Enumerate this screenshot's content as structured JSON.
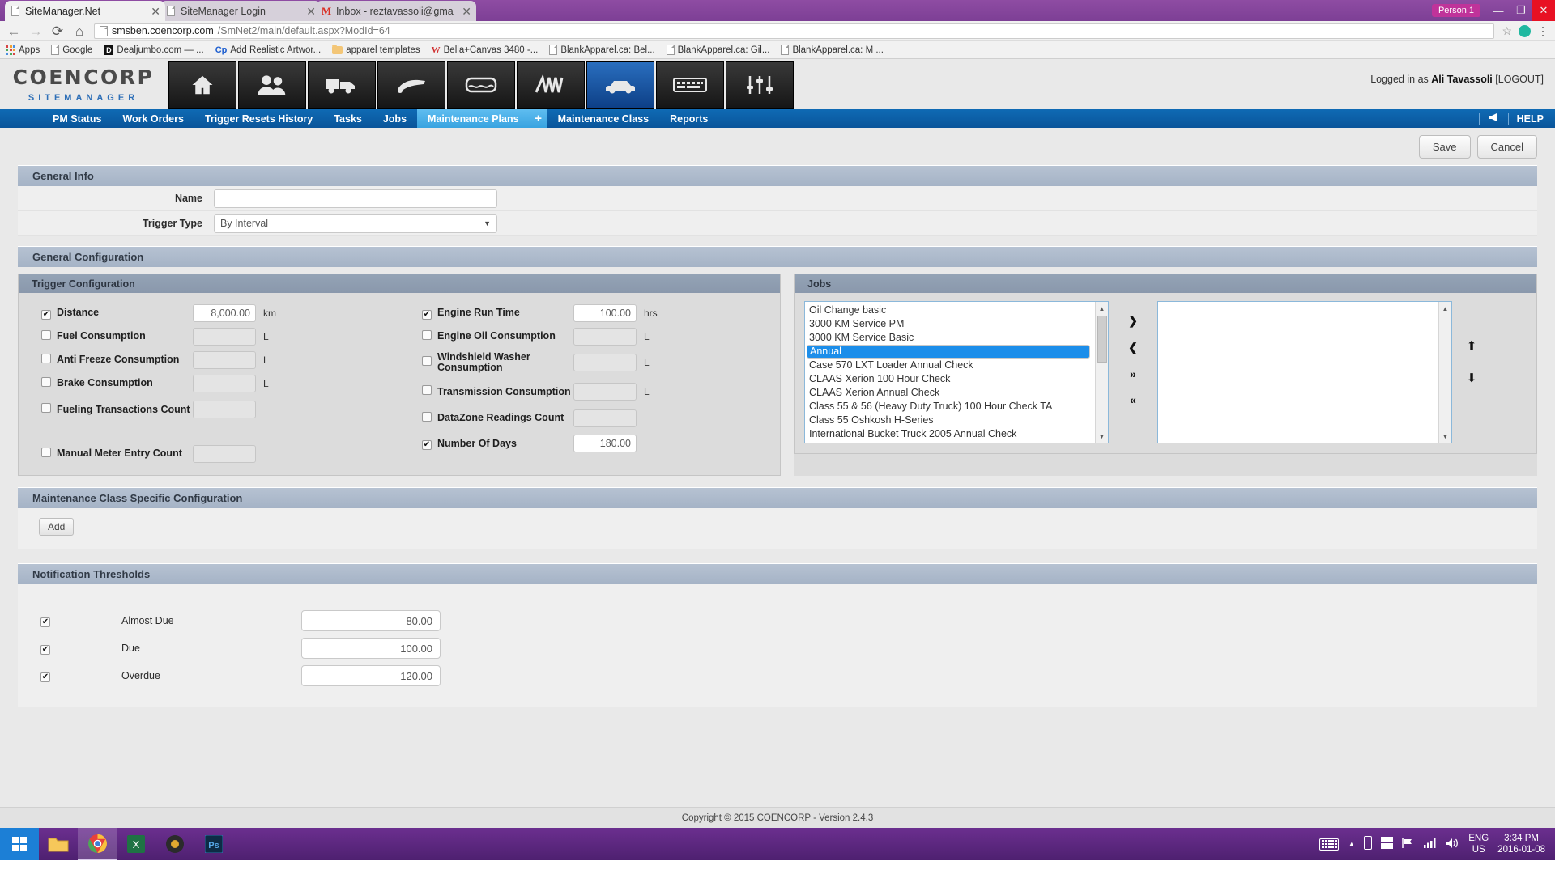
{
  "browser": {
    "tabs": [
      {
        "title": "SiteManager.Net",
        "icon": "document-icon",
        "active": true
      },
      {
        "title": "SiteManager Login",
        "icon": "document-icon",
        "active": false
      },
      {
        "title": "Inbox - reztavassoli@gma",
        "icon": "gmail-icon",
        "active": false
      }
    ],
    "window": {
      "person_label": "Person 1",
      "minimize": "—",
      "maximize": "❐",
      "close": "✕"
    },
    "toolbar": {
      "back": "←",
      "forward": "→",
      "reload": "⟳",
      "home": "⌂",
      "url_host": "smsben.coencorp.com",
      "url_path": "/SmNet2/main/default.aspx?ModId=64",
      "star": "☆",
      "menu": "⋮"
    },
    "bookmarks": [
      {
        "label": "Apps",
        "icon": "apps-grid-icon"
      },
      {
        "label": "Google",
        "icon": "document-icon"
      },
      {
        "label": "Dealjumbo.com — ...",
        "icon": "dealjumbo-icon"
      },
      {
        "label": "Add Realistic Artwor...",
        "icon": "cp-icon"
      },
      {
        "label": "apparel templates",
        "icon": "folder-icon"
      },
      {
        "label": "Bella+Canvas 3480 -...",
        "icon": "w-icon"
      },
      {
        "label": "BlankApparel.ca: Bel...",
        "icon": "document-icon"
      },
      {
        "label": "BlankApparel.ca: Gil...",
        "icon": "document-icon"
      },
      {
        "label": "BlankApparel.ca: M ...",
        "icon": "document-icon"
      }
    ]
  },
  "app": {
    "logo_main": "COENCORP",
    "logo_sub": "SITEMANAGER",
    "nav_icons": [
      {
        "name": "home-icon",
        "active": false
      },
      {
        "name": "people-icon",
        "active": false
      },
      {
        "name": "truck-icon",
        "active": false
      },
      {
        "name": "fuel-nozzle-icon",
        "active": false
      },
      {
        "name": "tank-icon",
        "active": false
      },
      {
        "name": "spring-icon",
        "active": false
      },
      {
        "name": "car-icon",
        "active": true
      },
      {
        "name": "keyboard-icon",
        "active": false
      },
      {
        "name": "sliders-icon",
        "active": false
      }
    ],
    "session": {
      "prefix": "Logged in as",
      "user": "Ali Tavassoli",
      "logout": "[LOGOUT]"
    },
    "nav_tabs": [
      {
        "label": "PM Status",
        "active": false
      },
      {
        "label": "Work Orders",
        "active": false
      },
      {
        "label": "Trigger Resets History",
        "active": false
      },
      {
        "label": "Tasks",
        "active": false
      },
      {
        "label": "Jobs",
        "active": false
      },
      {
        "label": "Maintenance Plans",
        "active": true
      },
      {
        "label": "Maintenance Class",
        "active": false
      },
      {
        "label": "Reports",
        "active": false
      }
    ],
    "nav_plus": "+",
    "nav_right": {
      "megaphone": "📢",
      "help": "HELP"
    }
  },
  "actions": {
    "save": "Save",
    "cancel": "Cancel"
  },
  "general_info": {
    "title": "General Info",
    "name_label": "Name",
    "name_value": "",
    "name_placeholder": "",
    "trigger_type_label": "Trigger Type",
    "trigger_type_value": "By Interval",
    "trigger_type_options": [
      "By Interval"
    ]
  },
  "general_config": {
    "title": "General Configuration",
    "trigger_config": {
      "title": "Trigger Configuration",
      "left": [
        {
          "label": "Distance",
          "checked": true,
          "value": "8,000.00",
          "unit": "km",
          "enabled": true
        },
        {
          "label": "Fuel Consumption",
          "checked": false,
          "value": "",
          "unit": "L",
          "enabled": false
        },
        {
          "label": "Anti Freeze Consumption",
          "checked": false,
          "value": "",
          "unit": "L",
          "enabled": false
        },
        {
          "label": "Brake Consumption",
          "checked": false,
          "value": "",
          "unit": "L",
          "enabled": false
        },
        {
          "label": "Fueling Transactions Count",
          "checked": false,
          "value": "",
          "unit": "",
          "enabled": false
        },
        {
          "label": "Manual Meter Entry Count",
          "checked": false,
          "value": "",
          "unit": "",
          "enabled": false
        }
      ],
      "right": [
        {
          "label": "Engine Run Time",
          "checked": true,
          "value": "100.00",
          "unit": "hrs",
          "enabled": true
        },
        {
          "label": "Engine Oil Consumption",
          "checked": false,
          "value": "",
          "unit": "L",
          "enabled": false
        },
        {
          "label": "Windshield Washer Consumption",
          "checked": false,
          "value": "",
          "unit": "L",
          "enabled": false
        },
        {
          "label": "Transmission Consumption",
          "checked": false,
          "value": "",
          "unit": "L",
          "enabled": false
        },
        {
          "label": "DataZone Readings Count",
          "checked": false,
          "value": "",
          "unit": "",
          "enabled": false
        },
        {
          "label": "Number Of Days",
          "checked": true,
          "value": "180.00",
          "unit": "",
          "enabled": true
        }
      ]
    },
    "jobs": {
      "title": "Jobs",
      "available": [
        {
          "label": "Oil Change basic",
          "selected": false
        },
        {
          "label": "3000 KM Service PM",
          "selected": false
        },
        {
          "label": "3000 KM Service Basic",
          "selected": false
        },
        {
          "label": "Annual",
          "selected": true
        },
        {
          "label": "Case 570 LXT Loader Annual Check",
          "selected": false
        },
        {
          "label": "CLAAS Xerion 100 Hour Check",
          "selected": false
        },
        {
          "label": "CLAAS Xerion Annual Check",
          "selected": false
        },
        {
          "label": "Class 55 & 56 (Heavy Duty Truck) 100 Hour Check TA",
          "selected": false
        },
        {
          "label": "Class 55 Oshkosh H-Series",
          "selected": false
        },
        {
          "label": "International Bucket Truck 2005 Annual Check",
          "selected": false
        }
      ],
      "assigned": [],
      "transfer": {
        "add": "❯",
        "remove": "❮",
        "add_all": "»",
        "remove_all": "«"
      },
      "reorder": {
        "up": "⬆",
        "down": "⬇"
      }
    }
  },
  "maintenance_class": {
    "title": "Maintenance Class Specific Configuration",
    "add_label": "Add"
  },
  "notification_thresholds": {
    "title": "Notification Thresholds",
    "rows": [
      {
        "label": "Almost Due",
        "checked": true,
        "value": "80.00"
      },
      {
        "label": "Due",
        "checked": true,
        "value": "100.00"
      },
      {
        "label": "Overdue",
        "checked": true,
        "value": "120.00"
      }
    ]
  },
  "footer": {
    "copyright": "Copyright © 2015 COENCORP - Version 2.4.3"
  },
  "taskbar": {
    "apps": [
      {
        "name": "file-explorer-icon"
      },
      {
        "name": "chrome-icon",
        "active": true
      },
      {
        "name": "excel-icon"
      },
      {
        "name": "media-icon"
      },
      {
        "name": "photoshop-icon",
        "label": "Ps"
      }
    ],
    "tray": {
      "keyboard": "keyboard-icon",
      "show_hidden": "▲",
      "battery": "battery-icon",
      "store": "store-icon",
      "flag": "flag-icon",
      "network": "network-icon",
      "volume": "volume-icon",
      "lang_line1": "ENG",
      "lang_line2": "US",
      "time": "3:34 PM",
      "date": "2016-01-08"
    }
  },
  "colors": {
    "brand_blue": "#0a559a",
    "active_tab": "#38a3e0",
    "section_header": "#a5b3c6",
    "selection": "#1c8eea",
    "taskbar": "#4e2070"
  }
}
